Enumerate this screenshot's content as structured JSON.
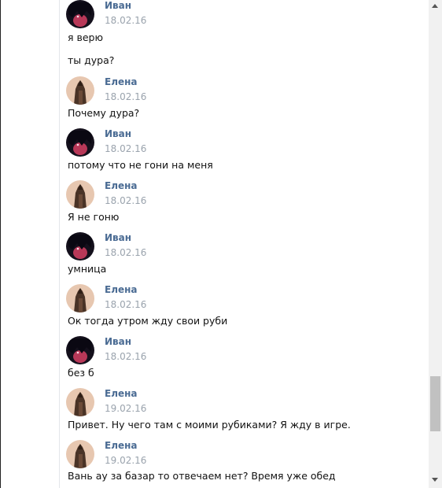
{
  "messages": [
    {
      "author": "Иван",
      "date": "18.02.16",
      "avatar": "ivan-avatar",
      "texts": [
        "я верю",
        "ты дура?"
      ]
    },
    {
      "author": "Елена",
      "date": "18.02.16",
      "avatar": "elena-avatar",
      "texts": [
        "Почему дура?"
      ]
    },
    {
      "author": "Иван",
      "date": "18.02.16",
      "avatar": "ivan-avatar",
      "texts": [
        "потому что не гони на меня"
      ]
    },
    {
      "author": "Елена",
      "date": "18.02.16",
      "avatar": "elena-avatar",
      "texts": [
        "Я не гоню"
      ]
    },
    {
      "author": "Иван",
      "date": "18.02.16",
      "avatar": "ivan-avatar",
      "texts": [
        "умница"
      ]
    },
    {
      "author": "Елена",
      "date": "18.02.16",
      "avatar": "elena-avatar",
      "texts": [
        "Ок тогда утром жду свои руби"
      ]
    },
    {
      "author": "Иван",
      "date": "18.02.16",
      "avatar": "ivan-avatar",
      "texts": [
        "без б"
      ]
    },
    {
      "author": "Елена",
      "date": "19.02.16",
      "avatar": "elena-avatar",
      "texts": [
        "Привет. Ну чего там с моими рубиками? Я жду в игре."
      ]
    },
    {
      "author": "Елена",
      "date": "19.02.16",
      "avatar": "elena-avatar",
      "texts": [
        "Вань ау за базар то отвечаем нет? Время уже обед"
      ]
    }
  ],
  "colors": {
    "author_link": "#4a6b93",
    "date_text": "#9aa3ad",
    "message_text": "#111111",
    "scrollbar_track": "#f1f1f1",
    "scrollbar_thumb": "#c1c1c1"
  }
}
